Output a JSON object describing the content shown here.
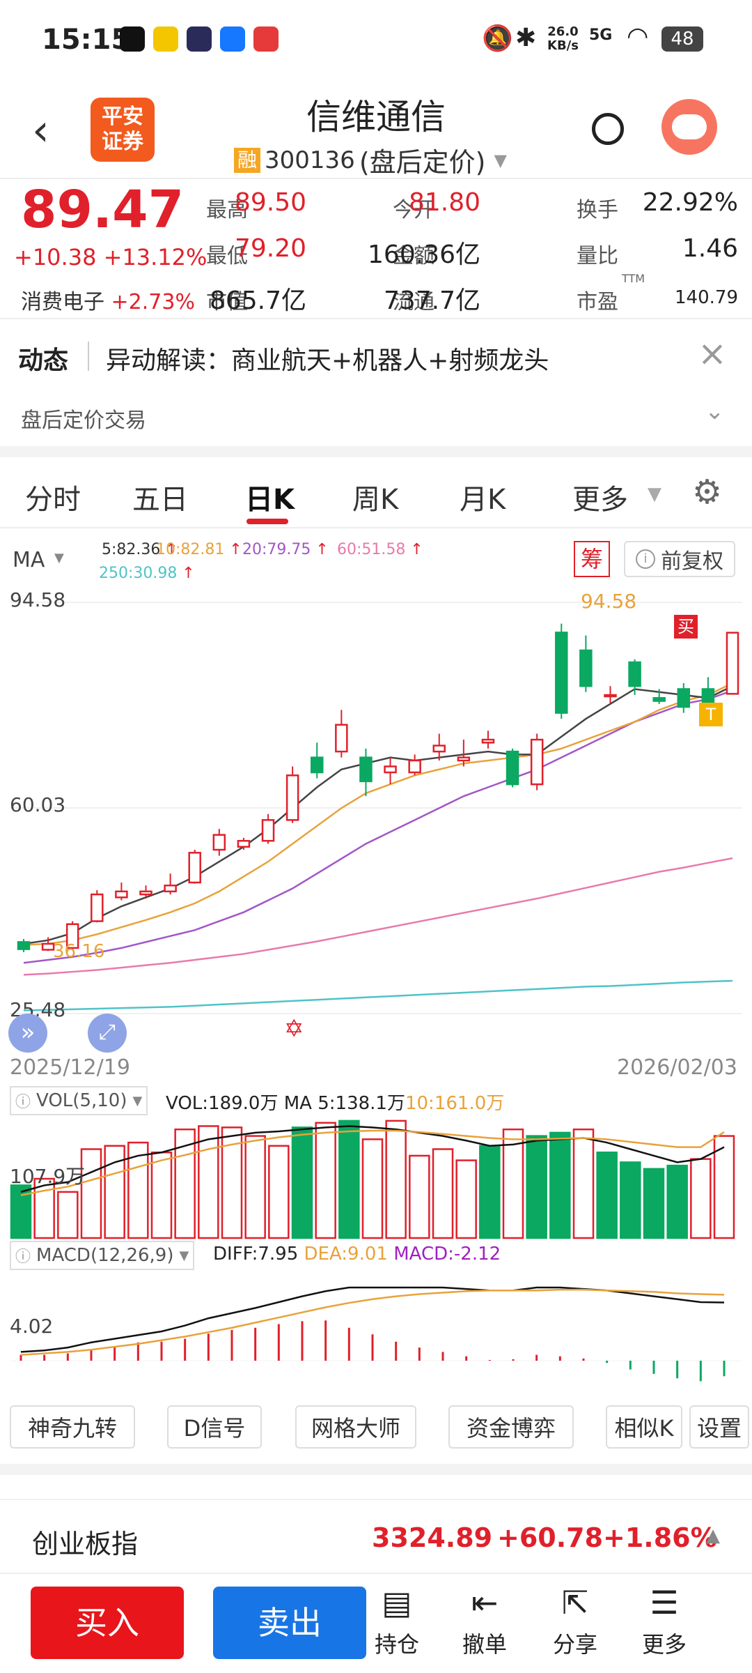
{
  "status": {
    "time": "15:15",
    "net_speed_top": "26.0",
    "net_speed_unit": "KB/s",
    "signal": "5G",
    "battery": "48"
  },
  "header": {
    "logo_line1": "平安",
    "logo_line2": "证券",
    "title": "信维通信",
    "rong_badge": "融",
    "code": "300136",
    "mode": "(盘后定价)"
  },
  "quote": {
    "price": "89.47",
    "change": "+10.38",
    "change_pct": "+13.12%",
    "sector": "消费电子",
    "sector_pct": "+2.73%",
    "cells": [
      {
        "label": "最高",
        "value": "89.50",
        "color": "#e0202a"
      },
      {
        "label": "今开",
        "value": "81.80",
        "color": "#e0202a"
      },
      {
        "label": "换手",
        "value": "22.92%",
        "color": "#222"
      },
      {
        "label": "最低",
        "value": "79.20",
        "color": "#e0202a"
      },
      {
        "label": "金额",
        "value": "160.36亿",
        "color": "#222"
      },
      {
        "label": "量比",
        "value": "1.46",
        "color": "#222"
      },
      {
        "label": "市值",
        "value": "865.7亿",
        "color": "#222"
      },
      {
        "label": "流通",
        "value": "737.7亿",
        "color": "#222"
      },
      {
        "label": "市盈",
        "value": "140.79",
        "color": "#222"
      }
    ],
    "pe_sup": "TTM"
  },
  "news": {
    "label": "动态",
    "text": "异动解读：商业航天+机器人+射频龙头"
  },
  "after_hours": "盘后定价交易",
  "tabs": [
    "分时",
    "五日",
    "日K",
    "周K",
    "月K",
    "更多"
  ],
  "active_tab": 2,
  "ma": {
    "label": "MA",
    "items": [
      {
        "text": "5:82.36",
        "color": "#333"
      },
      {
        "text": "10:82.81",
        "color": "#e8a23a"
      },
      {
        "text": "20:79.75",
        "color": "#a256c7"
      },
      {
        "text": "60:51.58",
        "color": "#e87aab"
      },
      {
        "text": "250:30.98",
        "color": "#4fc3c8"
      }
    ],
    "chou": "筹",
    "fq": "前复权"
  },
  "kchart": {
    "y_top": "94.58",
    "y_mid": "60.03",
    "y_bot": "25.48",
    "max_label": "94.58",
    "min_label": "36.16",
    "date_start": "2025/12/19",
    "date_end": "2026/02/03",
    "buy_tag": "买",
    "t_tag": "T"
  },
  "chart_data": {
    "type": "candlestick",
    "ylim": [
      25.48,
      94.58
    ],
    "candles": [
      [
        37.5,
        36.3,
        38.0,
        35.8
      ],
      [
        36.2,
        37.2,
        38.3,
        36.0
      ],
      [
        36.5,
        40.5,
        41.0,
        36.2
      ],
      [
        41.0,
        45.5,
        46.2,
        40.8
      ],
      [
        45.0,
        46.0,
        47.5,
        44.5
      ],
      [
        45.5,
        46.0,
        47.0,
        44.8
      ],
      [
        46.0,
        47.0,
        49.0,
        45.5
      ],
      [
        47.5,
        52.5,
        53.0,
        47.3
      ],
      [
        53.0,
        55.5,
        56.5,
        52.0
      ],
      [
        53.5,
        54.5,
        55.0,
        53.0
      ],
      [
        54.5,
        58.0,
        59.0,
        54.0
      ],
      [
        58.0,
        65.5,
        67.0,
        57.5
      ],
      [
        68.5,
        66.0,
        71.0,
        65.0
      ],
      [
        69.5,
        74.0,
        76.5,
        68.5
      ],
      [
        68.5,
        64.5,
        70.0,
        62.0
      ],
      [
        66.0,
        67.0,
        68.5,
        64.0
      ],
      [
        66.0,
        68.0,
        69.0,
        65.5
      ],
      [
        69.5,
        70.5,
        72.5,
        68.0
      ],
      [
        68.0,
        68.5,
        71.5,
        67.0
      ],
      [
        71.0,
        71.5,
        73.0,
        70.0
      ],
      [
        69.5,
        64.0,
        70.0,
        63.5
      ],
      [
        64.0,
        71.5,
        72.5,
        63.0
      ],
      [
        89.5,
        76.0,
        91.0,
        75.0
      ],
      [
        86.5,
        80.5,
        89.0,
        79.5
      ],
      [
        79.0,
        79.0,
        80.5,
        77.5
      ],
      [
        84.5,
        80.5,
        85.0,
        79.0
      ],
      [
        78.5,
        78.0,
        80.0,
        77.5
      ],
      [
        80.0,
        77.0,
        81.0,
        76.0
      ],
      [
        80.0,
        77.0,
        82.0,
        76.0
      ],
      [
        79.2,
        89.47,
        89.5,
        79.2
      ]
    ],
    "ma5": [
      37.2,
      37.8,
      39.0,
      41.5,
      43.5,
      45.0,
      46.5,
      48.5,
      51.0,
      53.5,
      56.5,
      60.0,
      63.5,
      66.5,
      67.5,
      68.5,
      68.0,
      68.5,
      69.0,
      69.5,
      69.0,
      69.0,
      72.0,
      75.0,
      77.5,
      80.0,
      79.5,
      79.0,
      78.5,
      80.5
    ],
    "ma10": [
      37.0,
      37.2,
      37.8,
      38.8,
      40.0,
      41.2,
      42.5,
      44.0,
      46.0,
      48.5,
      51.0,
      54.0,
      57.0,
      60.0,
      62.5,
      64.0,
      65.5,
      66.5,
      67.5,
      68.0,
      68.5,
      69.0,
      70.0,
      71.5,
      73.0,
      74.5,
      76.5,
      78.0,
      79.0,
      81.0
    ],
    "ma20": [
      34.0,
      34.5,
      35.0,
      35.7,
      36.5,
      37.5,
      38.5,
      39.5,
      41.0,
      42.5,
      44.5,
      46.5,
      49.0,
      51.5,
      54.0,
      56.0,
      58.0,
      60.0,
      62.0,
      63.5,
      65.0,
      66.5,
      68.5,
      70.5,
      72.5,
      74.5,
      76.0,
      77.5,
      78.3,
      79.75
    ],
    "ma60": [
      32.0,
      32.2,
      32.5,
      32.8,
      33.2,
      33.6,
      34.0,
      34.5,
      35.0,
      35.5,
      36.2,
      36.9,
      37.6,
      38.4,
      39.2,
      40.0,
      40.8,
      41.6,
      42.4,
      43.2,
      44.0,
      44.8,
      45.7,
      46.6,
      47.5,
      48.4,
      49.3,
      50.0,
      50.8,
      51.58
    ],
    "ma250": [
      26.0,
      26.1,
      26.2,
      26.3,
      26.4,
      26.5,
      26.6,
      26.8,
      27.0,
      27.2,
      27.4,
      27.6,
      27.8,
      28.0,
      28.2,
      28.4,
      28.6,
      28.8,
      29.0,
      29.2,
      29.4,
      29.6,
      29.8,
      30.0,
      30.1,
      30.3,
      30.5,
      30.7,
      30.85,
      30.98
    ],
    "vol": [
      80,
      90,
      70,
      135,
      140,
      145,
      130,
      165,
      170,
      168,
      155,
      140,
      168,
      175,
      178,
      150,
      178,
      125,
      135,
      118,
      140,
      165,
      155,
      160,
      165,
      130,
      115,
      105,
      110,
      120,
      155
    ],
    "vol_ma5": [
      70,
      80,
      85,
      100,
      115,
      125,
      130,
      140,
      150,
      155,
      160,
      162,
      165,
      168,
      170,
      168,
      165,
      160,
      155,
      148,
      140,
      142,
      148,
      150,
      152,
      145,
      135,
      125,
      115,
      120,
      138
    ],
    "vol_ma10": [
      65,
      72,
      78,
      88,
      98,
      108,
      118,
      126,
      135,
      142,
      148,
      153,
      157,
      160,
      162,
      163,
      163,
      161,
      158,
      155,
      152,
      150,
      150,
      151,
      152,
      150,
      146,
      142,
      138,
      138,
      161
    ],
    "diff": [
      1.2,
      1.4,
      1.8,
      2.5,
      3.0,
      3.5,
      4.0,
      4.8,
      5.8,
      6.5,
      7.2,
      8.0,
      8.8,
      9.5,
      10.0,
      10.0,
      10.0,
      10.0,
      10.0,
      9.8,
      9.6,
      9.6,
      10.0,
      10.0,
      9.8,
      9.6,
      9.2,
      8.8,
      8.4,
      8.0,
      7.95
    ],
    "dea": [
      0.8,
      1.0,
      1.2,
      1.5,
      1.9,
      2.3,
      2.8,
      3.3,
      3.9,
      4.5,
      5.2,
      5.9,
      6.6,
      7.3,
      7.9,
      8.4,
      8.8,
      9.1,
      9.3,
      9.5,
      9.6,
      9.6,
      9.6,
      9.7,
      9.7,
      9.6,
      9.5,
      9.4,
      9.2,
      9.1,
      9.01
    ],
    "macd": [
      0.8,
      0.8,
      1.0,
      1.5,
      2.0,
      2.5,
      2.6,
      3.0,
      3.7,
      4.2,
      4.5,
      5.0,
      5.4,
      5.5,
      4.5,
      3.6,
      2.6,
      1.8,
      1.2,
      0.6,
      0.1,
      0.2,
      0.8,
      0.6,
      0.3,
      -0.3,
      -1.2,
      -1.8,
      -2.4,
      -2.8,
      -2.12
    ]
  },
  "vol": {
    "label": "VOL(5,10)",
    "text": "VOL:189.0万 MA 5:138.1万",
    "ma10": "10:161.0万",
    "y_label": "107.9万"
  },
  "macd": {
    "label": "MACD(12,26,9)",
    "diff": "DIFF:7.95",
    "dea": "DEA:9.01",
    "macd": "MACD:-2.12",
    "y_label": "4.02"
  },
  "tools": [
    "神奇九转",
    "D信号",
    "网格大师",
    "资金博弈",
    "相似K",
    "设置"
  ],
  "index": {
    "name": "创业板指",
    "value": "3324.89",
    "change": "+60.78",
    "pct": "+1.86%"
  },
  "bottom": {
    "buy": "买入",
    "sell": "卖出",
    "items": [
      "持仓",
      "撤单",
      "分享",
      "更多"
    ]
  }
}
